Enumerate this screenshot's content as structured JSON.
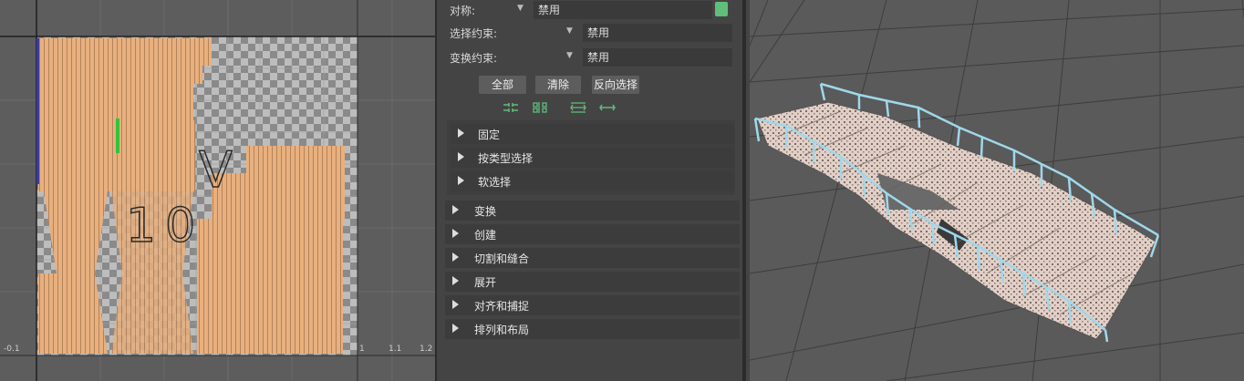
{
  "uv_editor": {
    "axis_ticks": [
      "-0.1",
      "1",
      "1.1",
      "1.2"
    ],
    "overlay_text_1": "V",
    "overlay_text_2": "10"
  },
  "toolkit": {
    "symmetry": {
      "label": "对称:",
      "value": "禁用"
    },
    "select_constraint": {
      "label": "选择约束:",
      "value": "禁用"
    },
    "transform_constraint": {
      "label": "变换约束:",
      "value": "禁用"
    },
    "buttons": {
      "all": "全部",
      "clear": "清除",
      "invert": "反向选择"
    },
    "subframes": [
      "固定",
      "按类型选择",
      "软选择"
    ],
    "frames": [
      "变换",
      "创建",
      "切割和缝合",
      "展开",
      "对齐和捕捉",
      "排列和布局"
    ]
  },
  "colors": {
    "uv_shell": "#e8b07e",
    "wire_highlight": "#9fd8ea",
    "accent_green": "#5fbf7a"
  }
}
